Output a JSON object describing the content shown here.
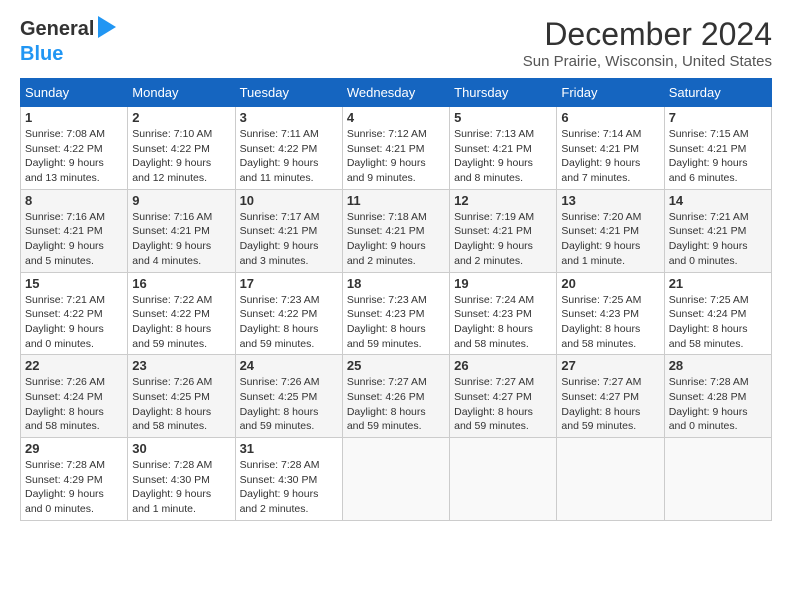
{
  "header": {
    "logo_general": "General",
    "logo_blue": "Blue",
    "month_title": "December 2024",
    "location": "Sun Prairie, Wisconsin, United States"
  },
  "days_of_week": [
    "Sunday",
    "Monday",
    "Tuesday",
    "Wednesday",
    "Thursday",
    "Friday",
    "Saturday"
  ],
  "weeks": [
    [
      {
        "day": "1",
        "sunrise": "Sunrise: 7:08 AM",
        "sunset": "Sunset: 4:22 PM",
        "daylight": "Daylight: 9 hours and 13 minutes."
      },
      {
        "day": "2",
        "sunrise": "Sunrise: 7:10 AM",
        "sunset": "Sunset: 4:22 PM",
        "daylight": "Daylight: 9 hours and 12 minutes."
      },
      {
        "day": "3",
        "sunrise": "Sunrise: 7:11 AM",
        "sunset": "Sunset: 4:22 PM",
        "daylight": "Daylight: 9 hours and 11 minutes."
      },
      {
        "day": "4",
        "sunrise": "Sunrise: 7:12 AM",
        "sunset": "Sunset: 4:21 PM",
        "daylight": "Daylight: 9 hours and 9 minutes."
      },
      {
        "day": "5",
        "sunrise": "Sunrise: 7:13 AM",
        "sunset": "Sunset: 4:21 PM",
        "daylight": "Daylight: 9 hours and 8 minutes."
      },
      {
        "day": "6",
        "sunrise": "Sunrise: 7:14 AM",
        "sunset": "Sunset: 4:21 PM",
        "daylight": "Daylight: 9 hours and 7 minutes."
      },
      {
        "day": "7",
        "sunrise": "Sunrise: 7:15 AM",
        "sunset": "Sunset: 4:21 PM",
        "daylight": "Daylight: 9 hours and 6 minutes."
      }
    ],
    [
      {
        "day": "8",
        "sunrise": "Sunrise: 7:16 AM",
        "sunset": "Sunset: 4:21 PM",
        "daylight": "Daylight: 9 hours and 5 minutes."
      },
      {
        "day": "9",
        "sunrise": "Sunrise: 7:16 AM",
        "sunset": "Sunset: 4:21 PM",
        "daylight": "Daylight: 9 hours and 4 minutes."
      },
      {
        "day": "10",
        "sunrise": "Sunrise: 7:17 AM",
        "sunset": "Sunset: 4:21 PM",
        "daylight": "Daylight: 9 hours and 3 minutes."
      },
      {
        "day": "11",
        "sunrise": "Sunrise: 7:18 AM",
        "sunset": "Sunset: 4:21 PM",
        "daylight": "Daylight: 9 hours and 2 minutes."
      },
      {
        "day": "12",
        "sunrise": "Sunrise: 7:19 AM",
        "sunset": "Sunset: 4:21 PM",
        "daylight": "Daylight: 9 hours and 2 minutes."
      },
      {
        "day": "13",
        "sunrise": "Sunrise: 7:20 AM",
        "sunset": "Sunset: 4:21 PM",
        "daylight": "Daylight: 9 hours and 1 minute."
      },
      {
        "day": "14",
        "sunrise": "Sunrise: 7:21 AM",
        "sunset": "Sunset: 4:21 PM",
        "daylight": "Daylight: 9 hours and 0 minutes."
      }
    ],
    [
      {
        "day": "15",
        "sunrise": "Sunrise: 7:21 AM",
        "sunset": "Sunset: 4:22 PM",
        "daylight": "Daylight: 9 hours and 0 minutes."
      },
      {
        "day": "16",
        "sunrise": "Sunrise: 7:22 AM",
        "sunset": "Sunset: 4:22 PM",
        "daylight": "Daylight: 8 hours and 59 minutes."
      },
      {
        "day": "17",
        "sunrise": "Sunrise: 7:23 AM",
        "sunset": "Sunset: 4:22 PM",
        "daylight": "Daylight: 8 hours and 59 minutes."
      },
      {
        "day": "18",
        "sunrise": "Sunrise: 7:23 AM",
        "sunset": "Sunset: 4:23 PM",
        "daylight": "Daylight: 8 hours and 59 minutes."
      },
      {
        "day": "19",
        "sunrise": "Sunrise: 7:24 AM",
        "sunset": "Sunset: 4:23 PM",
        "daylight": "Daylight: 8 hours and 58 minutes."
      },
      {
        "day": "20",
        "sunrise": "Sunrise: 7:25 AM",
        "sunset": "Sunset: 4:23 PM",
        "daylight": "Daylight: 8 hours and 58 minutes."
      },
      {
        "day": "21",
        "sunrise": "Sunrise: 7:25 AM",
        "sunset": "Sunset: 4:24 PM",
        "daylight": "Daylight: 8 hours and 58 minutes."
      }
    ],
    [
      {
        "day": "22",
        "sunrise": "Sunrise: 7:26 AM",
        "sunset": "Sunset: 4:24 PM",
        "daylight": "Daylight: 8 hours and 58 minutes."
      },
      {
        "day": "23",
        "sunrise": "Sunrise: 7:26 AM",
        "sunset": "Sunset: 4:25 PM",
        "daylight": "Daylight: 8 hours and 58 minutes."
      },
      {
        "day": "24",
        "sunrise": "Sunrise: 7:26 AM",
        "sunset": "Sunset: 4:25 PM",
        "daylight": "Daylight: 8 hours and 59 minutes."
      },
      {
        "day": "25",
        "sunrise": "Sunrise: 7:27 AM",
        "sunset": "Sunset: 4:26 PM",
        "daylight": "Daylight: 8 hours and 59 minutes."
      },
      {
        "day": "26",
        "sunrise": "Sunrise: 7:27 AM",
        "sunset": "Sunset: 4:27 PM",
        "daylight": "Daylight: 8 hours and 59 minutes."
      },
      {
        "day": "27",
        "sunrise": "Sunrise: 7:27 AM",
        "sunset": "Sunset: 4:27 PM",
        "daylight": "Daylight: 8 hours and 59 minutes."
      },
      {
        "day": "28",
        "sunrise": "Sunrise: 7:28 AM",
        "sunset": "Sunset: 4:28 PM",
        "daylight": "Daylight: 9 hours and 0 minutes."
      }
    ],
    [
      {
        "day": "29",
        "sunrise": "Sunrise: 7:28 AM",
        "sunset": "Sunset: 4:29 PM",
        "daylight": "Daylight: 9 hours and 0 minutes."
      },
      {
        "day": "30",
        "sunrise": "Sunrise: 7:28 AM",
        "sunset": "Sunset: 4:30 PM",
        "daylight": "Daylight: 9 hours and 1 minute."
      },
      {
        "day": "31",
        "sunrise": "Sunrise: 7:28 AM",
        "sunset": "Sunset: 4:30 PM",
        "daylight": "Daylight: 9 hours and 2 minutes."
      },
      null,
      null,
      null,
      null
    ]
  ]
}
